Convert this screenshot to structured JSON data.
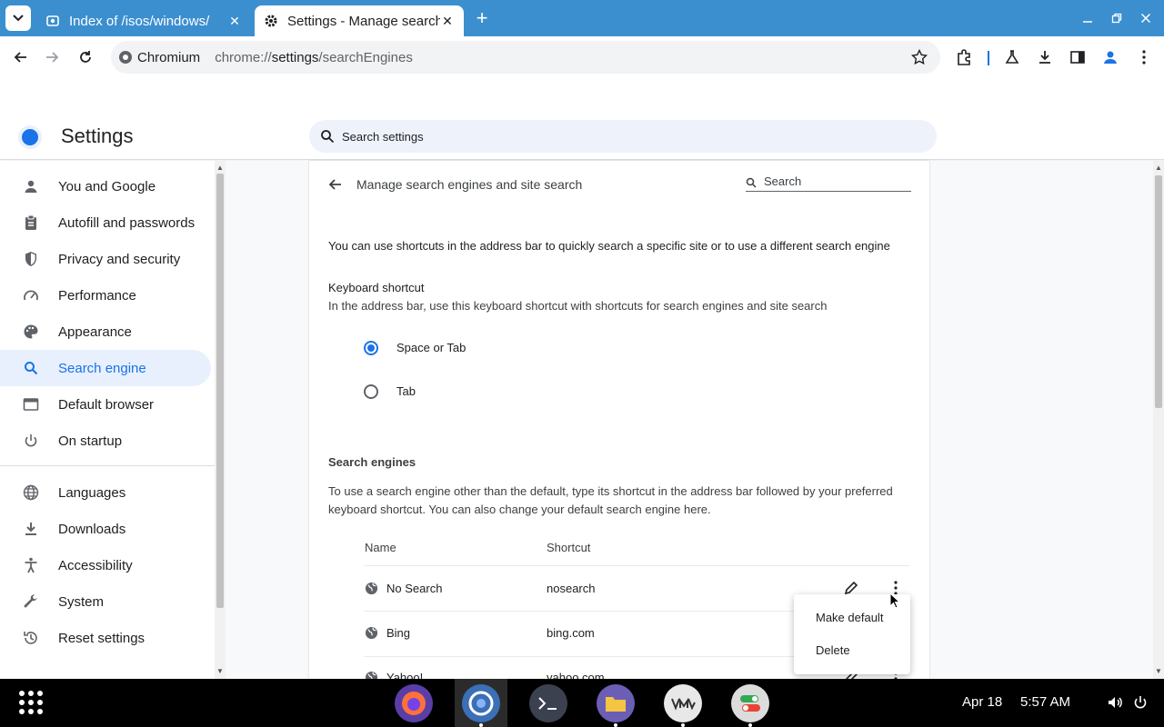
{
  "tabs": [
    {
      "title": "Index of /isos/windows/",
      "close": "✕"
    },
    {
      "title": "Settings - Manage search engines",
      "close": "✕"
    }
  ],
  "newtab": "+",
  "omnibox": {
    "chip": "Chromium",
    "url_prefix": "chrome://",
    "url_host": "settings",
    "url_path": "/searchEngines"
  },
  "settings": {
    "title": "Settings",
    "search_placeholder": "Search settings"
  },
  "sidebar": {
    "items": [
      {
        "label": "You and Google",
        "icon": "person-icon"
      },
      {
        "label": "Autofill and passwords",
        "icon": "clipboard-icon"
      },
      {
        "label": "Privacy and security",
        "icon": "shield-icon"
      },
      {
        "label": "Performance",
        "icon": "speedometer-icon"
      },
      {
        "label": "Appearance",
        "icon": "palette-icon"
      },
      {
        "label": "Search engine",
        "icon": "search-icon"
      },
      {
        "label": "Default browser",
        "icon": "browser-icon"
      },
      {
        "label": "On startup",
        "icon": "power-icon"
      },
      {
        "label": "Languages",
        "icon": "globe-icon"
      },
      {
        "label": "Downloads",
        "icon": "download-icon"
      },
      {
        "label": "Accessibility",
        "icon": "accessibility-icon"
      },
      {
        "label": "System",
        "icon": "wrench-icon"
      },
      {
        "label": "Reset settings",
        "icon": "history-icon"
      }
    ],
    "selected_index": 5
  },
  "page": {
    "title": "Manage search engines and site search",
    "search_placeholder": "Search",
    "intro": "You can use shortcuts in the address bar to quickly search a specific site or to use a different search engine",
    "keyboard_heading": "Keyboard shortcut",
    "keyboard_desc": "In the address bar, use this keyboard shortcut with shortcuts for search engines and site search",
    "options": [
      {
        "label": "Space or Tab",
        "selected": true
      },
      {
        "label": "Tab",
        "selected": false
      }
    ],
    "engines_heading": "Search engines",
    "engines_desc_1": "To use a search engine other than the default, type its shortcut in the address bar followed by your preferred",
    "engines_desc_2": "keyboard shortcut. You can also change your default search engine here.",
    "columns": {
      "name": "Name",
      "shortcut": "Shortcut"
    },
    "engines": [
      {
        "name": "No Search",
        "shortcut": "nosearch"
      },
      {
        "name": "Bing",
        "shortcut": "bing.com"
      },
      {
        "name": "Yahoo!",
        "shortcut": "yahoo.com"
      }
    ]
  },
  "context_menu": {
    "items": [
      "Make default",
      "Delete"
    ]
  },
  "taskbar": {
    "date": "Apr 18",
    "time": "5:57 AM"
  },
  "colors": {
    "accent": "#1a73e8",
    "titlebar": "#3b8fcf",
    "taskbar": "#000000",
    "selected_nav_bg": "#e8f0fe"
  }
}
